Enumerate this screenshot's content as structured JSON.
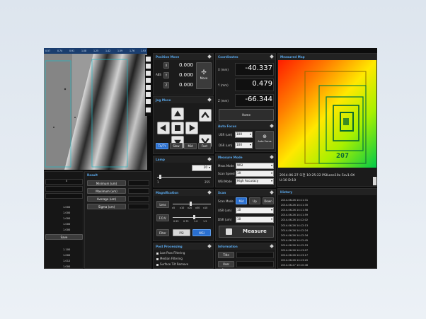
{
  "ruler": [
    "0.57",
    "0.74",
    "0.91",
    "1.08",
    "1.25",
    "1.42",
    "1.59",
    "1.76",
    "1.93"
  ],
  "position_move": {
    "title": "Position Move",
    "x": "0.000",
    "y": "0.000",
    "z": "0.000",
    "labels": [
      "X",
      "Y",
      "Z"
    ],
    "abs": "ABS",
    "move_label": "Move"
  },
  "jog_move": {
    "title": "Jog Move",
    "modes": [
      "TA/TY",
      "Slow",
      "Mid",
      "Fast"
    ]
  },
  "coordinates": {
    "title": "Coordinates",
    "x_label": "X (mm)",
    "x": "-40.337",
    "y_label": "Y (mm)",
    "y": "0.479",
    "z_label": "Z (mm)",
    "z": "-66.344",
    "home_label": "Home"
  },
  "auto_focus": {
    "title": "Auto Focus",
    "usr_label": "USR (um)",
    "usr_value": "100",
    "dsr_label": "DSR (um)",
    "dsr_value": "100",
    "button": "Auto Focus"
  },
  "measure_mode": {
    "title": "Measure Mode",
    "rows": [
      {
        "label": "Meas.Mode",
        "value": "WSI"
      },
      {
        "label": "Scan Speed",
        "value": "1X"
      },
      {
        "label": "WSI Mode",
        "value": "High Accuracy"
      }
    ]
  },
  "scan": {
    "title": "Scan",
    "scan_mode_label": "Scan Mode",
    "modes": [
      "Mid",
      "Up",
      "Down"
    ],
    "usr_label": "USR (um)",
    "usr_value": "10",
    "dsr_label": "DSR (um)",
    "dsr_value": "10",
    "measure": "Measure"
  },
  "lamp": {
    "title": "Lamp",
    "value": "20",
    "min": "1",
    "max": "255"
  },
  "magnification": {
    "title": "Magnification",
    "lens_label": "Lens",
    "lens_ticks": [
      "x5",
      "x10",
      "x20",
      "x50",
      "x10"
    ],
    "fov_label": "F.O.V.",
    "fov_ticks": [
      "0.55",
      "0.75",
      "1.0",
      "1.5"
    ],
    "filter_label": "Filter",
    "filters": [
      "PSI",
      "WSI"
    ]
  },
  "post_processing": {
    "title": "Post Processing",
    "items": [
      "Low Pass Filtering",
      "Median Filtering",
      "Surface Tilt Remove"
    ]
  },
  "information": {
    "title": "Information",
    "rows": [
      "Title",
      "User Name"
    ]
  },
  "measured_map": {
    "title": "Measured Map",
    "status_line1": "2014-06-27 오전 10:25:22 PSILens10x Fov1.0X",
    "status_line2": "U:10 D:10",
    "map_text": "207"
  },
  "history": {
    "title": "History",
    "entries": [
      "2014-06-26 14:11:31",
      "2014-06-26 14:11:35",
      "2014-06-26 14:11:58",
      "2014-06-26 14:11:59",
      "2014-06-26 14:12:02",
      "2014-06-26 14:12:13",
      "2014-06-26 14:12:24",
      "2014-06-26 14:12:34",
      "2014-06-26 14:12:45",
      "2014-06-26 14:12:53",
      "2014-06-26 14:13:07",
      "2014-06-26 14:13:17",
      "2014-06-26 14:13:20",
      "2014-06-27 10:10:46"
    ]
  },
  "result": {
    "title": "Result",
    "rows": [
      "Minimum (um)",
      "Maximum (um)",
      "Average (um)",
      "Sigma (um)"
    ]
  },
  "left_table": {
    "top_value": "5",
    "values_a": [
      "1.000",
      "1.000",
      "1.000",
      "1.000",
      "1.000"
    ],
    "save_label": "Save",
    "values_b": [
      "1.100",
      "1.000",
      "1.012",
      "1.000",
      "1.000"
    ]
  },
  "colors": {
    "accent": "#59a7ea",
    "active": "#2a6fcf",
    "bg": "#0c0c0c"
  }
}
